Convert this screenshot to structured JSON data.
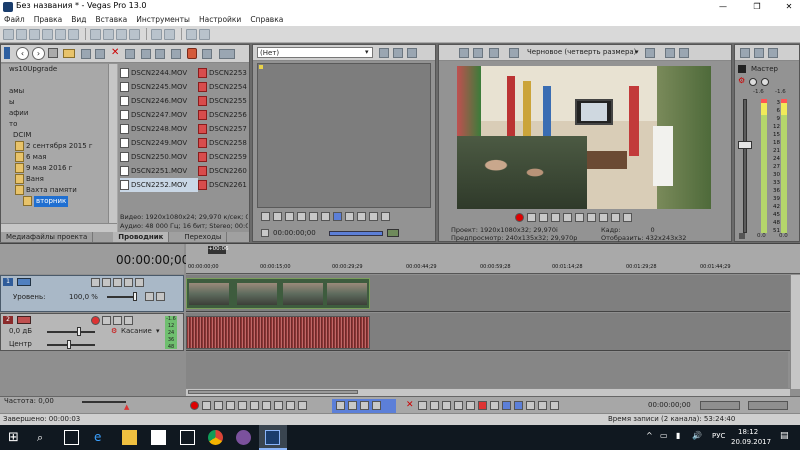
{
  "window": {
    "title": "Без названия * - Vegas Pro 13.0"
  },
  "menu": [
    "Файл",
    "Правка",
    "Вид",
    "Вставка",
    "Инструменты",
    "Настройки",
    "Справка"
  ],
  "explorer": {
    "tree": [
      "ws10Upgrade",
      "",
      "амы",
      "ы",
      "афии",
      "то",
      "DCIM",
      "2 сентября 2015 г",
      "6 мая",
      "9 мая 2016 г",
      "Ваня",
      "Вахта памяти",
      "вторник"
    ],
    "files_left": [
      "DSCN2244.MOV",
      "DSCN2245.MOV",
      "DSCN2246.MOV",
      "DSCN2247.MOV",
      "DSCN2248.MOV",
      "DSCN2249.MOV",
      "DSCN2250.MOV",
      "DSCN2251.MOV",
      "DSCN2252.MOV"
    ],
    "files_right": [
      "DSCN2253",
      "DSCN2254",
      "DSCN2255",
      "DSCN2256",
      "DSCN2257",
      "DSCN2258",
      "DSCN2259",
      "DSCN2260",
      "DSCN2261"
    ],
    "info_video": "Видео: 1920x1080x24; 29,970 к/сек; 00:",
    "info_audio": "Аудио: 48 000 Гц; 16 бит; Stereo; 00:00",
    "tabs": [
      "Медиафайлы проекта",
      "Проводник",
      "Переходы"
    ]
  },
  "trimmer": {
    "dropdown": "(Нет)",
    "timecode": "00:00:00;00"
  },
  "preview": {
    "quality": "Черновое (четверть размера)",
    "project_label": "Проект:",
    "project_value": "1920x1080x32; 29,970i",
    "preview_label": "Предпросмотр:",
    "preview_value": "240x135x32; 29,970p",
    "frame_label": "Кадр:",
    "frame_value": "0",
    "display_label": "Отобразить:",
    "display_value": "432x243x32"
  },
  "master": {
    "title": "Мастер",
    "left": "-1.6",
    "right": "-1.6",
    "scale": [
      "3",
      "6",
      "9",
      "12",
      "15",
      "18",
      "21",
      "24",
      "27",
      "30",
      "33",
      "36",
      "39",
      "42",
      "45",
      "48",
      "51",
      "54",
      "57"
    ],
    "bottom_left": "0.0",
    "bottom_right": "0.0"
  },
  "timeline": {
    "timecode": "00:00:00;00",
    "marker": "+00:06",
    "ruler": [
      "00:00:00;00",
      "00:00:15;00",
      "00:00:29;29",
      "00:00:44;29",
      "00:00:59;28",
      "00:01:14;28",
      "00:01:29;28",
      "00:01:44;29"
    ],
    "video_track": {
      "num": "1",
      "level_label": "Уровень:",
      "level_value": "100,0 %"
    },
    "audio_track": {
      "num": "2",
      "vol": "0,0 дБ",
      "pan": "Центр",
      "mode": "Касание",
      "meter": [
        "-1.6",
        "12",
        "24",
        "36",
        "48"
      ]
    },
    "rate_label": "Частота: 0,00",
    "end_tc": "00:00:00;00"
  },
  "status": {
    "left": "Завершено: 00:00:03",
    "right": "Время записи (2 канала): 53:24:40"
  },
  "taskbar": {
    "lang": "РУС",
    "time": "18:12",
    "date": "20.09.2017"
  }
}
